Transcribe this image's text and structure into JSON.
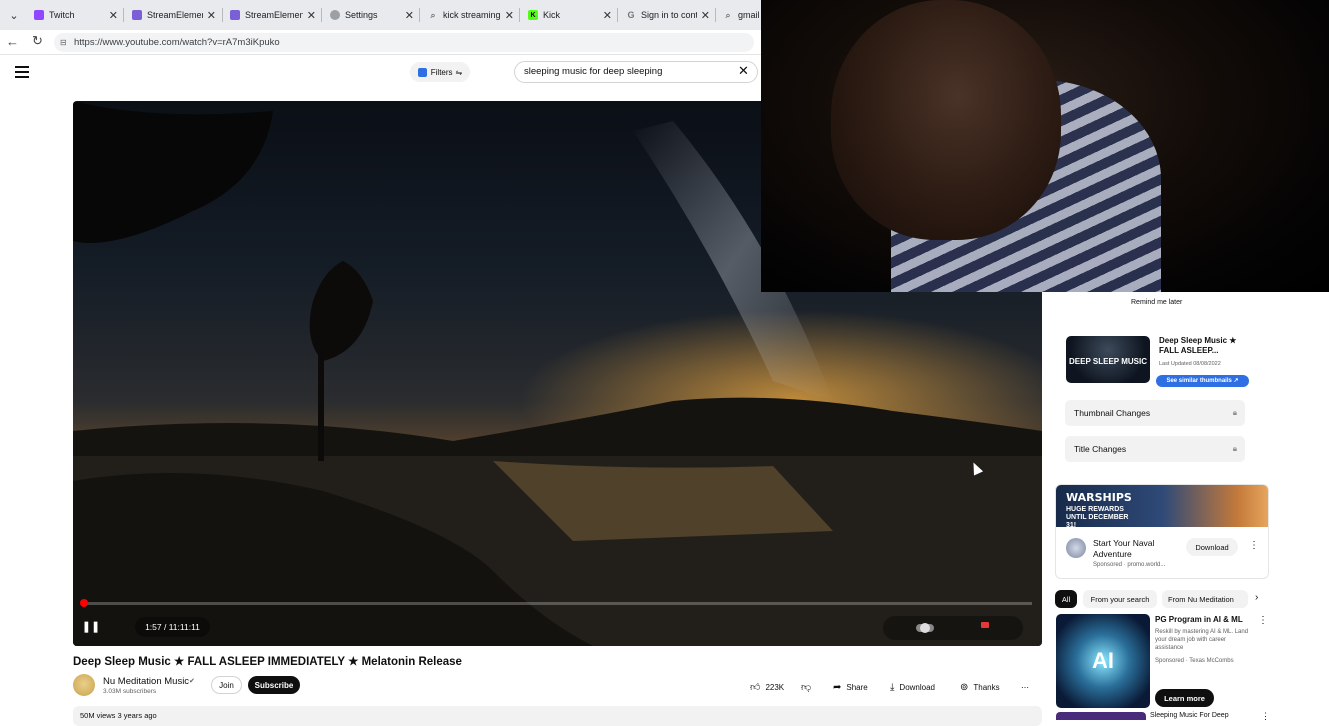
{
  "browser": {
    "tabs": [
      {
        "label": "Twitch",
        "favicon_color": "#9146ff"
      },
      {
        "label": "StreamElement",
        "favicon_color": "#7b5fd6"
      },
      {
        "label": "StreamElement",
        "favicon_color": "#7b5fd6"
      },
      {
        "label": "Settings",
        "favicon_color": "#6b6b6b"
      },
      {
        "label": "kick streaming",
        "favicon_color": "#6b6b6b"
      },
      {
        "label": "Kick",
        "favicon_color": "#53fc18"
      },
      {
        "label": "Sign in to conti",
        "favicon_color": "#6b6b6b"
      },
      {
        "label": "gmail",
        "favicon_color": "#6b6b6b"
      }
    ],
    "url": "https://www.youtube.com/watch?v=rA7m3iKpuko"
  },
  "youtube_header": {
    "filters_label": "Filters",
    "search_value": "sleeping music for deep sleeping"
  },
  "player": {
    "time": "1:57 / 11:11:11",
    "progress_fraction": 0.003,
    "accent": "#ff0000"
  },
  "video": {
    "title": "Deep Sleep Music ★ FALL ASLEEP IMMEDIATELY ★ Melatonin Release",
    "channel_name": "Nu Meditation Music",
    "subscribers": "3.03M subscribers",
    "join_label": "Join",
    "subscribe_label": "Subscribe",
    "likes": "223K",
    "share_label": "Share",
    "download_label": "Download",
    "thanks_label": "Thanks",
    "views_date": "50M views  3 years ago"
  },
  "sidebar": {
    "remind_label": "Remind me later",
    "vidiq": {
      "thumb_text": "DEEP SLEEP MUSIC",
      "title": "Deep Sleep Music ★ FALL ASLEEP...",
      "updated": "Last Updated 08/08/2022",
      "see_similar": "See similar thumbnails ↗",
      "rows": [
        "Thumbnail Changes",
        "Title Changes"
      ]
    },
    "ad": {
      "brand": "WARSHIPS",
      "banner_text": "HUGE REWARDS UNTIL DECEMBER 31!",
      "title": "Start Your Naval Adventure",
      "sponsored": "Sponsored · promo.world...",
      "cta": "Download"
    },
    "chips": [
      "All",
      "From your search",
      "From Nu Meditation"
    ],
    "promo": {
      "thumb_text": "AI",
      "title": "PG Program in AI & ML",
      "desc": "Reskill by mastering AI & ML. Land your dream job with career assistance",
      "sponsored": "Sponsored · Texas McCombs",
      "cta": "Learn more"
    },
    "next_title": "Sleeping Music For Deep"
  }
}
